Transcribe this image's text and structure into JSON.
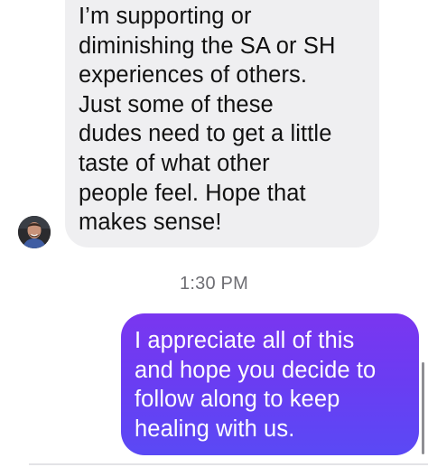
{
  "incoming_message": {
    "lines": [
      "I’m supporting or",
      "diminishing the SA or SH",
      "experiences of others.",
      "Just some of these",
      "dudes need to get a little",
      "taste of what other",
      "people feel. Hope that",
      "makes sense!"
    ]
  },
  "timestamp": "1:30 PM",
  "outgoing_message": {
    "lines": [
      "I appreciate all of this",
      "and hope you decide to",
      "follow along to keep",
      "healing with us."
    ]
  },
  "icons": {
    "avatar": "profile-photo"
  },
  "colors": {
    "incoming_bubble": "#efeff1",
    "outgoing_bubble_top": "#7a36f0",
    "outgoing_bubble_bottom": "#5a49f5",
    "timestamp": "#6e6e73"
  }
}
